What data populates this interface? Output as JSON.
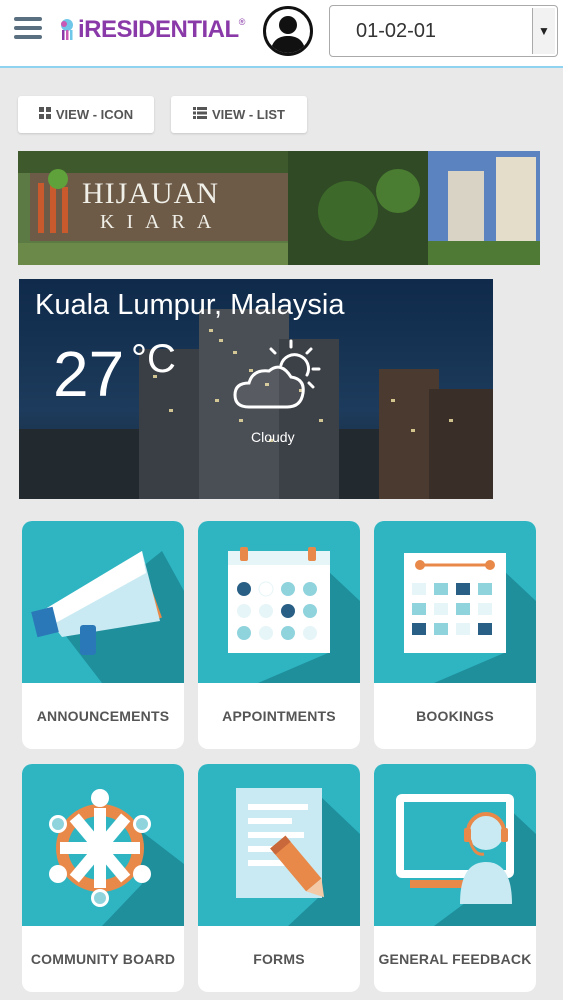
{
  "header": {
    "logo_text": "iRESIDENTIAL",
    "logo_reg": "®",
    "unit_selected": "01-02-01"
  },
  "view_buttons": {
    "icon_label": "VIEW - ICON",
    "list_label": "VIEW - LIST"
  },
  "banner": {
    "title": "HIJAUAN",
    "subtitle": "KIARA"
  },
  "weather": {
    "location": "Kuala Lumpur, Malaysia",
    "temperature": "27",
    "unit": "°C",
    "condition": "Cloudy",
    "icon": "partly-cloudy-icon"
  },
  "tiles": [
    {
      "label": "ANNOUNCEMENTS",
      "icon": "megaphone-icon"
    },
    {
      "label": "APPOINTMENTS",
      "icon": "calendar-icon"
    },
    {
      "label": "BOOKINGS",
      "icon": "booking-calendar-icon"
    },
    {
      "label": "COMMUNITY BOARD",
      "icon": "community-icon"
    },
    {
      "label": "FORMS",
      "icon": "form-icon"
    },
    {
      "label": "GENERAL FEEDBACK",
      "icon": "support-agent-icon"
    }
  ],
  "colors": {
    "brand": "#8a3aa8",
    "tile_bg": "#2fb5c2",
    "tile_shadow": "#1f8f9c",
    "accent_orange": "#e8894a",
    "page_bg": "#e9e9ea"
  }
}
